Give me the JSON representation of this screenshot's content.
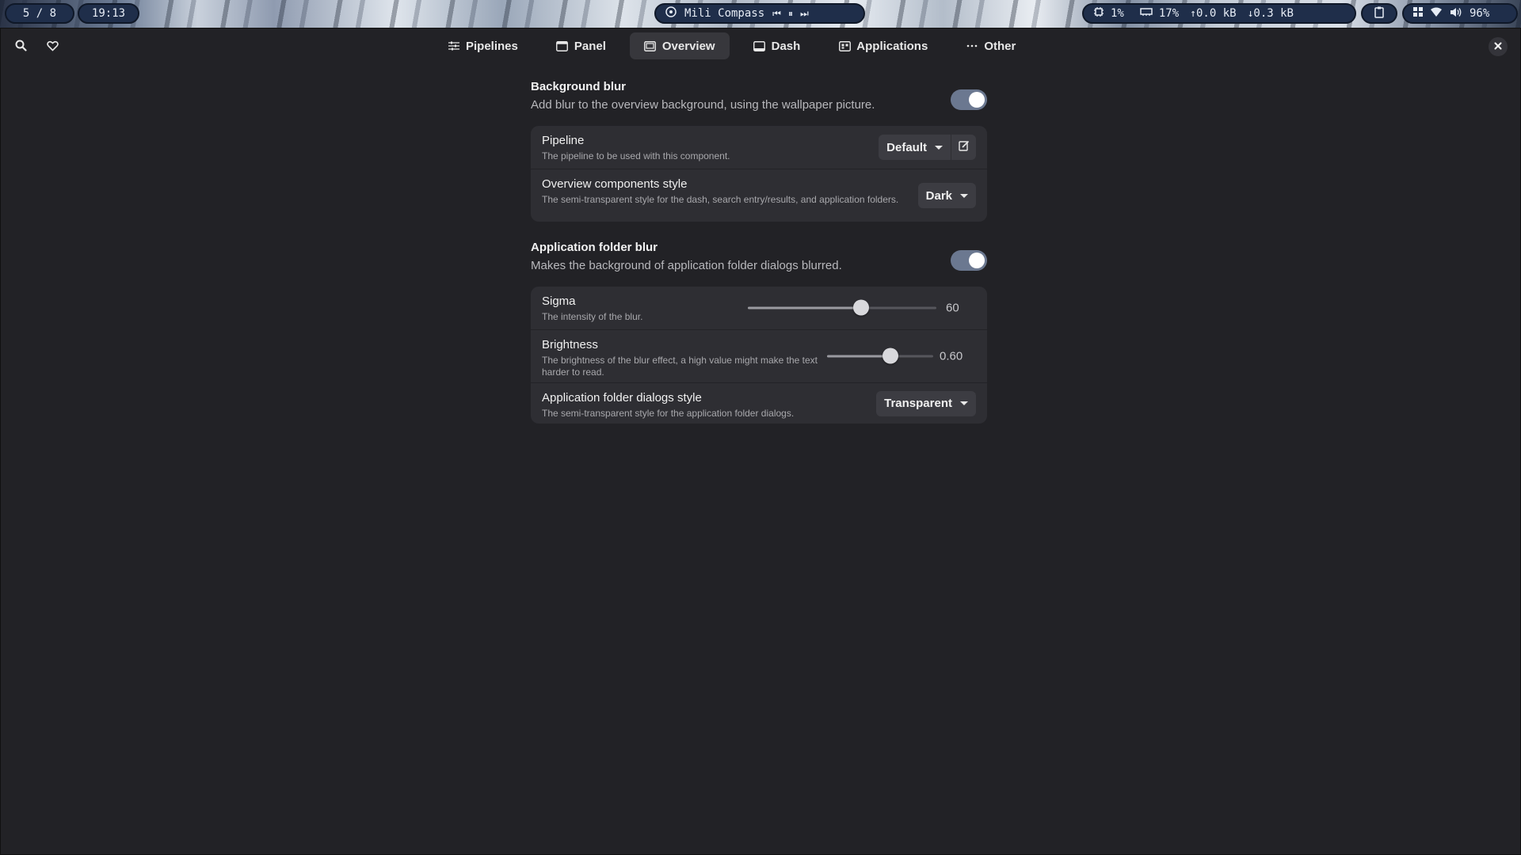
{
  "topbar": {
    "workspace": "5 / 8",
    "clock": "19:13",
    "media_title": "Mili Compass",
    "cpu": "1%",
    "memory": "17%",
    "net_up": "0.0 kB",
    "net_down": "0.3 kB",
    "volume": "96%"
  },
  "header": {
    "tabs": [
      {
        "label": "Pipelines",
        "icon": "sliders-icon"
      },
      {
        "label": "Panel",
        "icon": "panel-icon"
      },
      {
        "label": "Overview",
        "icon": "overview-icon",
        "active": true
      },
      {
        "label": "Dash",
        "icon": "dash-icon"
      },
      {
        "label": "Applications",
        "icon": "applications-icon"
      },
      {
        "label": "Other",
        "icon": "more-icon"
      }
    ]
  },
  "background_blur": {
    "title": "Background blur",
    "description": "Add blur to the overview background, using the wallpaper picture.",
    "enabled": true,
    "pipeline": {
      "title": "Pipeline",
      "subtitle": "The pipeline to be used with this component.",
      "value": "Default"
    },
    "style": {
      "title": "Overview components style",
      "subtitle": "The semi-transparent style for the dash, search entry/results, and application folders.",
      "value": "Dark"
    }
  },
  "folder_blur": {
    "title": "Application folder blur",
    "description": "Makes the background of application folder dialogs blurred.",
    "enabled": true,
    "sigma": {
      "title": "Sigma",
      "subtitle": "The intensity of the blur.",
      "value": "60",
      "fraction": 0.6
    },
    "brightness": {
      "title": "Brightness",
      "subtitle": "The brightness of the blur effect, a high value might make the text harder to read.",
      "value": "0.60",
      "fraction": 0.6
    },
    "dialog_style": {
      "title": "Application folder dialogs style",
      "subtitle": "The semi-transparent style for the application folder dialogs.",
      "value": "Transparent"
    }
  },
  "colors": {
    "background": "#222226",
    "card": "#2e2e33",
    "switch_on": "#6b7890",
    "topbar_pill": "#1f2e4a"
  }
}
